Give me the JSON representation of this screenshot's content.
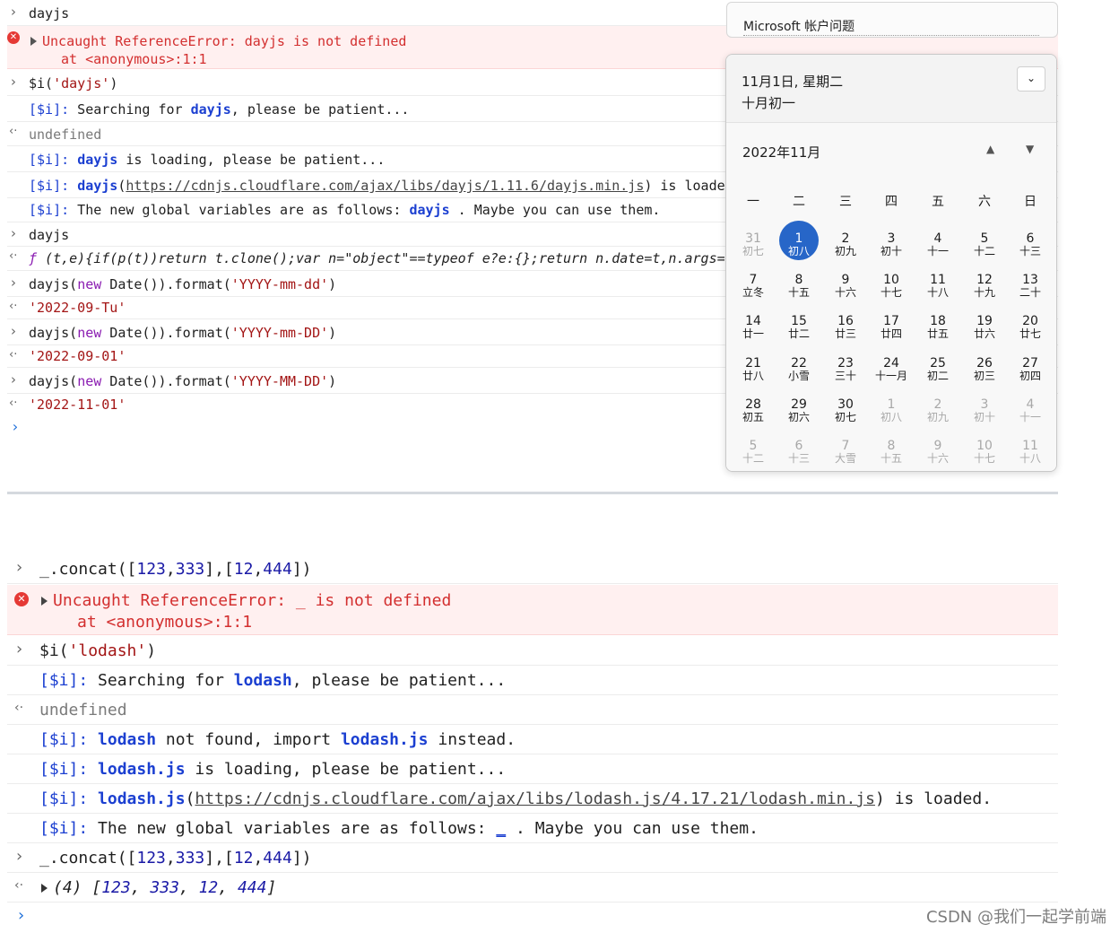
{
  "console1": {
    "r1": "dayjs",
    "r2_err": "Uncaught ReferenceError: dayjs is not defined",
    "r2_at": "at <anonymous>:1:1",
    "r3_a": "$i(",
    "r3_b": "'dayjs'",
    "r3_c": ")",
    "r4_a": "[$i]:",
    "r4_b": " Searching for ",
    "r4_c": "dayjs",
    "r4_d": ", please be patient...",
    "r5": "undefined",
    "r6_a": "[$i]:",
    "r6_b": "dayjs",
    "r6_c": " is loading, please be patient...",
    "r7_a": "[$i]:",
    "r7_b": "dayjs",
    "r7_c": "(",
    "r7_link": "https://cdnjs.cloudflare.com/ajax/libs/dayjs/1.11.6/dayjs.min.js",
    "r7_d": ") is loade",
    "r8_a": "[$i]:",
    "r8_b": " The new global variables are as follows: ",
    "r8_c": "dayjs",
    "r8_d": " . Maybe you can use them.",
    "r9": "dayjs",
    "r10_f": "ƒ",
    "r10": " (t,e){if(p(t))return t.clone();var n=\"object\"==typeof e?e:{};return n.date=t,n.args=",
    "r11_a": "dayjs(",
    "r11_kw": "new",
    "r11_b": " Date()).format(",
    "r11_s": "'YYYY-mm-dd'",
    "r11_c": ")",
    "r12": "'2022-09-Tu'",
    "r13_a": "dayjs(",
    "r13_kw": "new",
    "r13_b": " Date()).format(",
    "r13_s": "'YYYY-mm-DD'",
    "r13_c": ")",
    "r14": "'2022-09-01'",
    "r15_a": "dayjs(",
    "r15_kw": "new",
    "r15_b": " Date()).format(",
    "r15_s": "'YYYY-MM-DD'",
    "r15_c": ")",
    "r16": "'2022-11-01'"
  },
  "flyout": {
    "ms_title": "Microsoft 帐户问题",
    "date_full": "11月1日, 星期二",
    "lunar": "十月初一",
    "month": "2022年11月",
    "weekdays": [
      "一",
      "二",
      "三",
      "四",
      "五",
      "六",
      "日"
    ],
    "days": [
      {
        "n": "31",
        "l": "初七",
        "dim": true
      },
      {
        "n": "1",
        "l": "初八",
        "today": true
      },
      {
        "n": "2",
        "l": "初九"
      },
      {
        "n": "3",
        "l": "初十"
      },
      {
        "n": "4",
        "l": "十一"
      },
      {
        "n": "5",
        "l": "十二"
      },
      {
        "n": "6",
        "l": "十三"
      },
      {
        "n": "7",
        "l": "立冬"
      },
      {
        "n": "8",
        "l": "十五"
      },
      {
        "n": "9",
        "l": "十六"
      },
      {
        "n": "10",
        "l": "十七"
      },
      {
        "n": "11",
        "l": "十八"
      },
      {
        "n": "12",
        "l": "十九"
      },
      {
        "n": "13",
        "l": "二十"
      },
      {
        "n": "14",
        "l": "廿一"
      },
      {
        "n": "15",
        "l": "廿二"
      },
      {
        "n": "16",
        "l": "廿三"
      },
      {
        "n": "17",
        "l": "廿四"
      },
      {
        "n": "18",
        "l": "廿五"
      },
      {
        "n": "19",
        "l": "廿六"
      },
      {
        "n": "20",
        "l": "廿七"
      },
      {
        "n": "21",
        "l": "廿八"
      },
      {
        "n": "22",
        "l": "小雪"
      },
      {
        "n": "23",
        "l": "三十"
      },
      {
        "n": "24",
        "l": "十一月"
      },
      {
        "n": "25",
        "l": "初二"
      },
      {
        "n": "26",
        "l": "初三"
      },
      {
        "n": "27",
        "l": "初四"
      },
      {
        "n": "28",
        "l": "初五"
      },
      {
        "n": "29",
        "l": "初六"
      },
      {
        "n": "30",
        "l": "初七"
      },
      {
        "n": "1",
        "l": "初八",
        "dim": true
      },
      {
        "n": "2",
        "l": "初九",
        "dim": true
      },
      {
        "n": "3",
        "l": "初十",
        "dim": true
      },
      {
        "n": "4",
        "l": "十一",
        "dim": true
      },
      {
        "n": "5",
        "l": "十二",
        "dim": true
      },
      {
        "n": "6",
        "l": "十三",
        "dim": true
      },
      {
        "n": "7",
        "l": "大雪",
        "dim": true
      },
      {
        "n": "8",
        "l": "十五",
        "dim": true
      },
      {
        "n": "9",
        "l": "十六",
        "dim": true
      },
      {
        "n": "10",
        "l": "十七",
        "dim": true
      },
      {
        "n": "11",
        "l": "十八",
        "dim": true
      }
    ]
  },
  "console2": {
    "r1_a": "_.concat([",
    "r1_n1": "123",
    "r1_c1": ",",
    "r1_n2": "333",
    "r1_b": "],[",
    "r1_n3": "12",
    "r1_c2": ",",
    "r1_n4": "444",
    "r1_c": "])",
    "r2_err": "Uncaught ReferenceError: _ is not defined",
    "r2_at": "at <anonymous>:1:1",
    "r3_a": "$i(",
    "r3_b": "'lodash'",
    "r3_c": ")",
    "r4_a": "[$i]:",
    "r4_b": " Searching for ",
    "r4_c": "lodash",
    "r4_d": ", please be patient...",
    "r5": "undefined",
    "r6_a": "[$i]:",
    "r6_b": "lodash",
    "r6_c": " not found, import ",
    "r6_d": "lodash.js",
    "r6_e": " instead.",
    "r7_a": "[$i]:",
    "r7_b": "lodash.js",
    "r7_c": " is loading, please be patient...",
    "r8_a": "[$i]:",
    "r8_b": "lodash.js",
    "r8_c": "(",
    "r8_link": "https://cdnjs.cloudflare.com/ajax/libs/lodash.js/4.17.21/lodash.min.js",
    "r8_d": ") is loaded.",
    "r9_a": "[$i]:",
    "r9_b": " The new global variables are as follows: ",
    "r9_c": "_",
    "r9_d": " . Maybe you can use them.",
    "r10_a": "_.concat([",
    "r10_n1": "123",
    "r10_c1": ",",
    "r10_n2": "333",
    "r10_b": "],[",
    "r10_n3": "12",
    "r10_c2": ",",
    "r10_n4": "444",
    "r10_c": "])",
    "r11_a": "(4) [",
    "r11_n1": "123",
    "r11_b": ", ",
    "r11_n2": "333",
    "r11_c": ", ",
    "r11_n3": "12",
    "r11_d": ", ",
    "r11_n4": "444",
    "r11_e": "]"
  },
  "watermark": "CSDN @我们一起学前端",
  "colors": {
    "error_bg": "#fff0f0",
    "error_text": "#d32f2f",
    "today": "#2766c8",
    "link_blue": "#1b3fd1"
  }
}
